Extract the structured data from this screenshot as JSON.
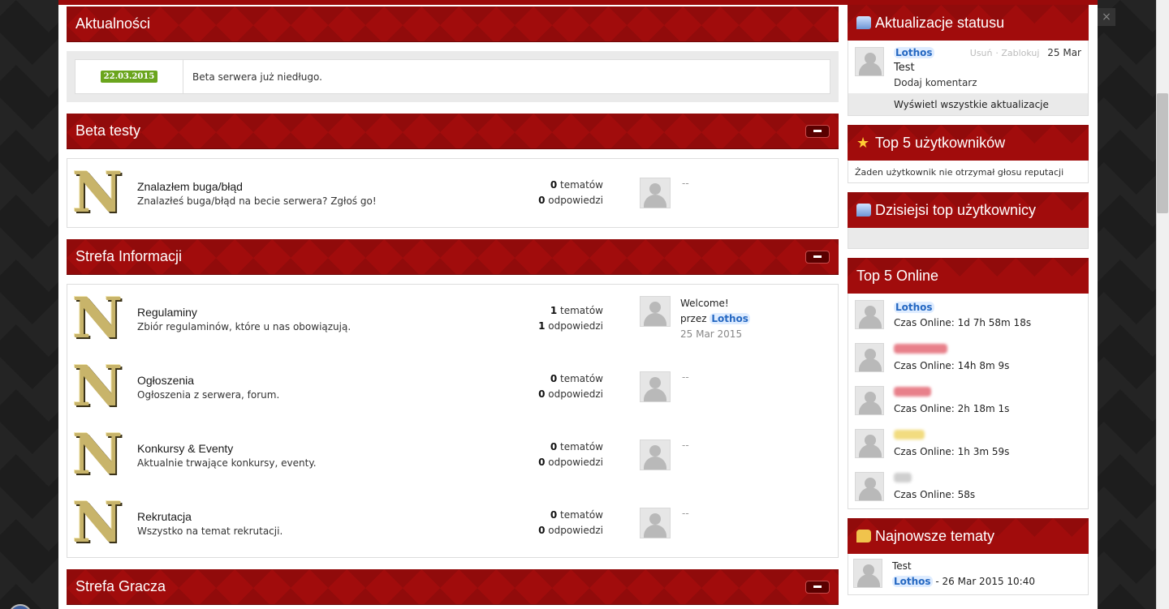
{
  "news": {
    "title": "Aktualności",
    "date": "22.03.2015",
    "text": "Beta serwera już niedługo."
  },
  "categories": [
    {
      "title": "Beta testy",
      "forums": [
        {
          "title": "Znalazłem buga/błąd",
          "desc": "Znalazłeś buga/błąd na becie serwera? Zgłoś go!",
          "topics": "0",
          "topics_label": "tematów",
          "posts": "0",
          "posts_label": "odpowiedzi",
          "last": "--"
        }
      ]
    },
    {
      "title": "Strefa Informacji",
      "forums": [
        {
          "title": "Regulaminy",
          "desc": "Zbiór regulaminów, które u nas obowiązują.",
          "topics": "1",
          "topics_label": "tematów",
          "posts": "1",
          "posts_label": "odpowiedzi",
          "last_title": "Welcome!",
          "last_by": "przez",
          "last_user": "Lothos",
          "last_date": "25 Mar 2015"
        },
        {
          "title": "Ogłoszenia",
          "desc": "Ogłoszenia z serwera, forum.",
          "topics": "0",
          "topics_label": "tematów",
          "posts": "0",
          "posts_label": "odpowiedzi",
          "last": "--"
        },
        {
          "title": "Konkursy & Eventy",
          "desc": "Aktualnie trwające konkursy, eventy.",
          "topics": "0",
          "topics_label": "tematów",
          "posts": "0",
          "posts_label": "odpowiedzi",
          "last": "--"
        },
        {
          "title": "Rekrutacja",
          "desc": "Wszystko na temat rekrutacji.",
          "topics": "0",
          "topics_label": "tematów",
          "posts": "0",
          "posts_label": "odpowiedzi",
          "last": "--"
        }
      ]
    },
    {
      "title": "Strefa Gracza"
    }
  ],
  "sidebar": {
    "status": {
      "title": "Aktualizacje statusu",
      "user": "Lothos",
      "delete": "Usuń",
      "block": "Zablokuj",
      "date": "25 Mar",
      "text": "Test",
      "comment": "Dodaj komentarz",
      "show_all": "Wyświetl wszystkie aktualizacje"
    },
    "top5": {
      "title": "Top 5 użytkowników",
      "text": "Żaden użytkownik nie otrzymał głosu reputacji"
    },
    "today": {
      "title": "Dzisiejsi top użytkownicy"
    },
    "online": {
      "title": "Top 5 Online",
      "users": [
        {
          "name": "Lothos",
          "time": "Czas Online: 1d 7h 58m 18s"
        },
        {
          "name": "",
          "time": "Czas Online: 14h 8m 9s"
        },
        {
          "name": "",
          "time": "Czas Online: 2h 18m 1s"
        },
        {
          "name": "",
          "time": "Czas Online: 1h 3m 59s"
        },
        {
          "name": "",
          "time": "Czas Online: 58s"
        }
      ]
    },
    "newest": {
      "title": "Najnowsze tematy",
      "topic": "Test",
      "user": "Lothos",
      "meta": " - 26 Mar 2015 10:40"
    }
  },
  "colors": {
    "accent": "#a10c0c",
    "badge": "#6aa51d",
    "link": "#2568c2"
  },
  "icons": {
    "forum": "N",
    "close": "×"
  }
}
